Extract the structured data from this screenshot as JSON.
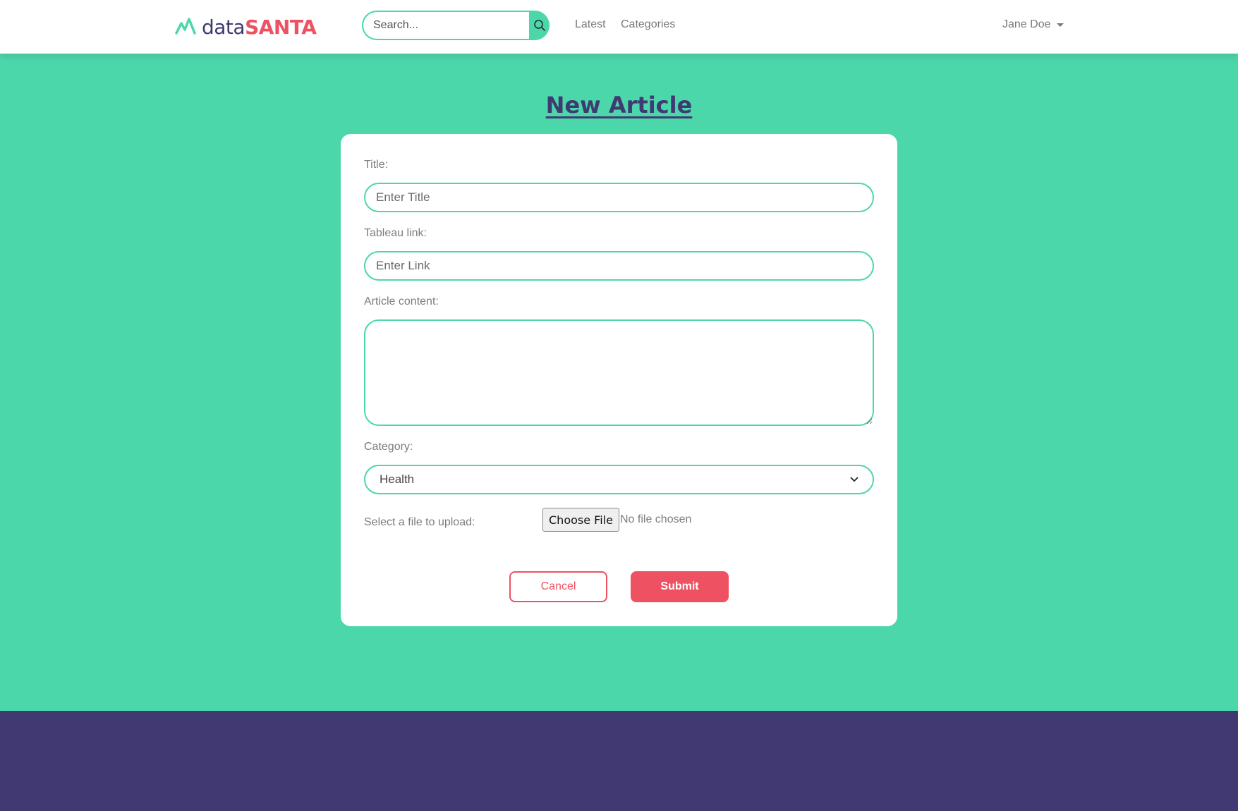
{
  "brand": {
    "name_part1": "data",
    "name_part2": "SANTA",
    "icon": "mountain-logo-icon"
  },
  "navbar": {
    "search_placeholder": "Search...",
    "search_icon": "search-icon",
    "links": {
      "latest": "Latest",
      "categories": "Categories"
    },
    "user_name": "Jane Doe"
  },
  "page": {
    "title": "New Article"
  },
  "form": {
    "title_label": "Title:",
    "title_placeholder": "Enter Title",
    "link_label": "Tableau link:",
    "link_placeholder": "Enter Link",
    "content_label": "Article content:",
    "content_value": "",
    "category_label": "Category:",
    "category_selected": "Health",
    "file_label": "Select a file to upload:",
    "file_button": "Choose File",
    "file_status": "No file chosen",
    "cancel_label": "Cancel",
    "submit_label": "Submit"
  },
  "colors": {
    "background": "#4cd7ab",
    "primary": "#ee5161",
    "brand_dark": "#3f3a72",
    "footer": "#413a72"
  }
}
